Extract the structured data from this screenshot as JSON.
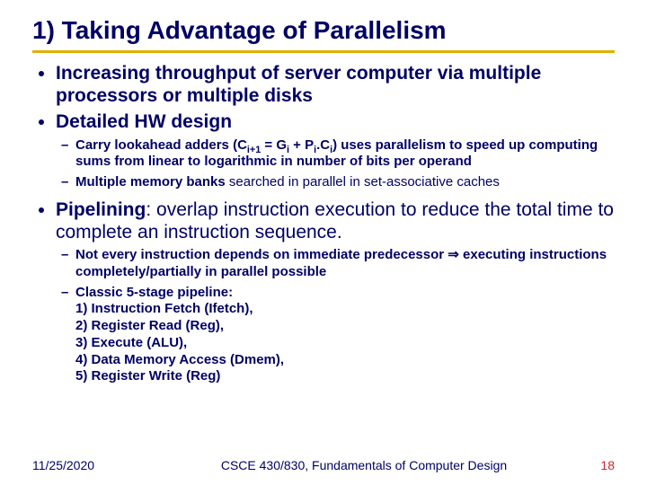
{
  "title": "1) Taking Advantage of Parallelism",
  "bullets": {
    "b1": "Increasing throughput of server computer via multiple processors or multiple disks",
    "b2": "Detailed HW design",
    "b2s1_pre": "Carry lookahead adders (C",
    "b2s1_sub1": "i+1",
    "b2s1_mid1": " = G",
    "b2s1_sub2": "i",
    "b2s1_mid2": " + P",
    "b2s1_sub3": "i",
    "b2s1_mid3": ".C",
    "b2s1_sub4": "i",
    "b2s1_post": ") uses parallelism to speed up computing sums from linear to logarithmic in number of bits per operand",
    "b2s2_strong": "Multiple memory banks",
    "b2s2_rest": " searched in parallel in set-associative caches",
    "b3_strong": "Pipelining",
    "b3_rest": ": overlap instruction execution to reduce the total time to complete an instruction sequence.",
    "b3s1": "Not every instruction depends on immediate predecessor ⇒ executing instructions completely/partially in parallel possible",
    "b3s2_lead": "Classic 5-stage pipeline:",
    "b3s2_stage1": "1) Instruction Fetch (Ifetch),",
    "b3s2_stage2": "2) Register Read (Reg),",
    "b3s2_stage3": "3) Execute (ALU),",
    "b3s2_stage4": "4) Data Memory Access (Dmem),",
    "b3s2_stage5": "5) Register Write (Reg)"
  },
  "footer": {
    "date": "11/25/2020",
    "course": "CSCE 430/830, Fundamentals of Computer Design",
    "page": "18"
  }
}
